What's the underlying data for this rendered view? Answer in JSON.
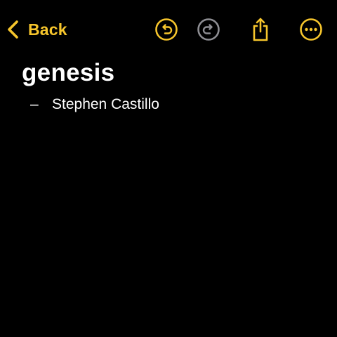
{
  "toolbar": {
    "back_label": "Back",
    "accent_color": "#f6c52c",
    "disabled_color": "#8e8e93",
    "icons": [
      "chevron-left-icon",
      "undo-icon",
      "redo-icon",
      "share-icon",
      "more-icon"
    ]
  },
  "note": {
    "title": "genesis",
    "lines": [
      {
        "marker": "–",
        "text": "Stephen Castillo"
      }
    ]
  }
}
